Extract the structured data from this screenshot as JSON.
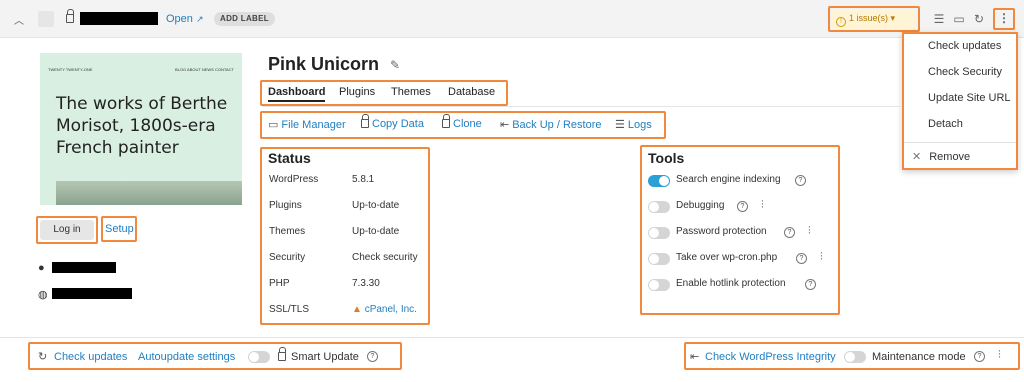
{
  "topbar": {
    "open_label": "Open",
    "add_label": "ADD LABEL",
    "issues_label": "1 issue(s)"
  },
  "menu": {
    "items": [
      "Check updates",
      "Check Security",
      "Update Site URL",
      "Detach"
    ],
    "remove_label": "Remove"
  },
  "preview": {
    "site_name_small": "TWENTY TWENTY-ONE",
    "nav_small": "BLOG   ABOUT   NEWS   CONTACT",
    "headline": "The works of Berthe Morisot, 1800s-era French painter"
  },
  "left": {
    "login_label": "Log in",
    "setup_label": "Setup"
  },
  "site": {
    "title": "Pink Unicorn",
    "tabs": [
      "Dashboard",
      "Plugins",
      "Themes",
      "Database"
    ]
  },
  "actions": [
    "File Manager",
    "Copy Data",
    "Clone",
    "Back Up / Restore",
    "Logs"
  ],
  "status": {
    "title": "Status",
    "rows": [
      {
        "label": "WordPress",
        "value": "5.8.1"
      },
      {
        "label": "Plugins",
        "value": "Up-to-date"
      },
      {
        "label": "Themes",
        "value": "Up-to-date"
      },
      {
        "label": "Security",
        "value": "Check security"
      },
      {
        "label": "PHP",
        "value": "7.3.30"
      },
      {
        "label": "SSL/TLS",
        "value": "cPanel, Inc."
      }
    ]
  },
  "tools": {
    "title": "Tools",
    "items": [
      {
        "label": "Search engine indexing",
        "on": true
      },
      {
        "label": "Debugging",
        "on": false
      },
      {
        "label": "Password protection",
        "on": false
      },
      {
        "label": "Take over wp-cron.php",
        "on": false
      },
      {
        "label": "Enable hotlink protection",
        "on": false
      }
    ]
  },
  "footer": {
    "check_updates": "Check updates",
    "autoupdate": "Autoupdate settings",
    "smart_update": "Smart Update",
    "integrity": "Check WordPress Integrity",
    "maintenance": "Maintenance mode"
  },
  "colors": {
    "accent": "#1f7fc1",
    "highlight": "#f0883e",
    "toggle_on": "#2b9fd8"
  }
}
